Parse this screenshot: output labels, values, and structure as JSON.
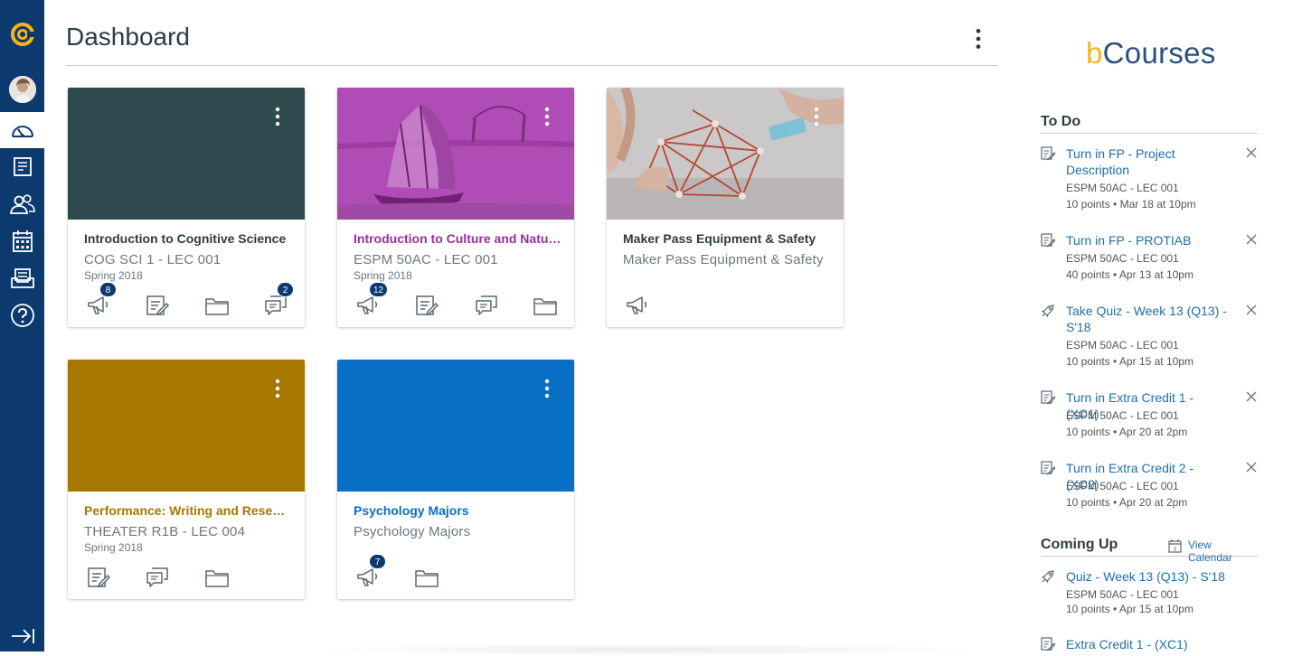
{
  "nav": {
    "items": [
      "logo",
      "account",
      "dashboard",
      "courses",
      "groups",
      "calendar",
      "inbox",
      "help",
      "collapse"
    ],
    "active": "dashboard"
  },
  "header": {
    "title": "Dashboard"
  },
  "courses": [
    {
      "name": "Introduction to Cognitive Science",
      "code": "COG SCI 1 - LEC 001",
      "term": "Spring 2018",
      "color": "#2e4a4f",
      "name_color": "#2d3b45",
      "icons": [
        {
          "icon": "announcements-icon",
          "badge": "8"
        },
        {
          "icon": "assignments-icon",
          "badge": ""
        },
        {
          "icon": "files-icon",
          "badge": ""
        },
        {
          "icon": "discussions-icon",
          "badge": "2"
        }
      ]
    },
    {
      "name": "Introduction to Culture and Natural Resource Management",
      "code": "ESPM 50AC - LEC 001",
      "term": "Spring 2018",
      "color": "#b04cb5",
      "name_color": "#9a2d9f",
      "icons": [
        {
          "icon": "announcements-icon",
          "badge": "12"
        },
        {
          "icon": "assignments-icon",
          "badge": ""
        },
        {
          "icon": "discussions-icon",
          "badge": ""
        },
        {
          "icon": "files-icon",
          "badge": ""
        }
      ]
    },
    {
      "name": "Maker Pass Equipment & Safety",
      "code": "Maker Pass Equipment & Safety",
      "term": "",
      "color": "#c9c6c7",
      "name_color": "#2d3b45",
      "icons": [
        {
          "icon": "announcements-icon",
          "badge": ""
        }
      ]
    },
    {
      "name": "Performance: Writing and Research",
      "code": "THEATER R1B - LEC 004",
      "term": "Spring 2018",
      "color": "#a77800",
      "name_color": "#a77800",
      "icons": [
        {
          "icon": "assignments-icon",
          "badge": ""
        },
        {
          "icon": "discussions-icon",
          "badge": ""
        },
        {
          "icon": "files-icon",
          "badge": ""
        }
      ]
    },
    {
      "name": "Psychology Majors",
      "code": "Psychology Majors",
      "term": "",
      "color": "#0770c6",
      "name_color": "#0770c6",
      "icons": [
        {
          "icon": "announcements-icon",
          "badge": "7"
        },
        {
          "icon": "files-icon",
          "badge": ""
        }
      ]
    }
  ],
  "sidebar": {
    "brand_b": "b",
    "brand_rest": "Courses",
    "todo_title": "To Do",
    "todo": [
      {
        "icon": "assignment-icon",
        "title": "Turn in FP - Project Description",
        "course": "ESPM 50AC - LEC 001",
        "due": "10 points • Mar 18 at 10pm"
      },
      {
        "icon": "assignment-icon",
        "title": "Turn in FP - PROTIAB",
        "course": "ESPM 50AC - LEC 001",
        "due": "40 points • Apr 13 at 10pm"
      },
      {
        "icon": "quiz-icon",
        "title": "Take Quiz - Week 13 (Q13) - S'18",
        "course": "ESPM 50AC - LEC 001",
        "due": "10 points • Apr 15 at 10pm"
      },
      {
        "icon": "assignment-icon",
        "title": "Turn in Extra Credit 1 - (XC1)",
        "course": "ESPM 50AC - LEC 001",
        "due": "10 points • Apr 20 at 2pm"
      },
      {
        "icon": "assignment-icon",
        "title": "Turn in Extra Credit 2 - (XC2)",
        "course": "ESPM 50AC - LEC 001",
        "due": "10 points • Apr 20 at 2pm"
      }
    ],
    "coming_title": "Coming Up",
    "view_calendar": "View Calendar",
    "coming": [
      {
        "icon": "quiz-icon",
        "title": "Quiz - Week 13 (Q13) - S'18",
        "course": "ESPM 50AC - LEC 001",
        "due": "10 points • Apr 15 at 10pm"
      },
      {
        "icon": "assignment-icon",
        "title": "Extra Credit 1 - (XC1)",
        "course": "",
        "due": ""
      }
    ]
  }
}
